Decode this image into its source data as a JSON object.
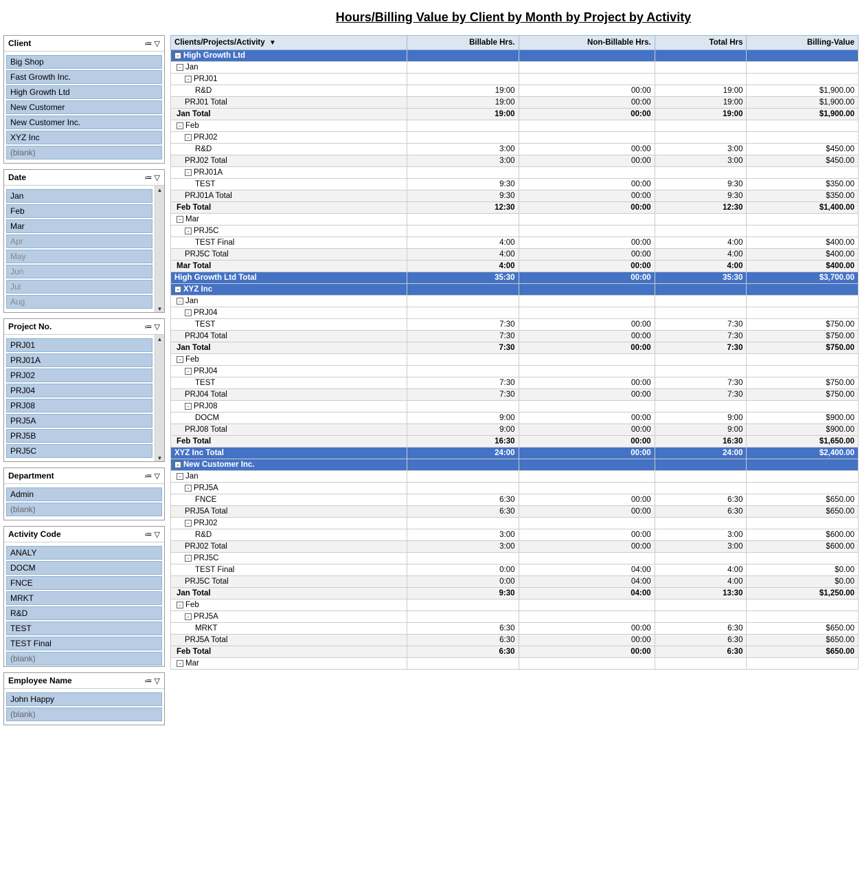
{
  "title": "Hours/Billing Value by Client by Month by Project by Activity",
  "filters": {
    "client": {
      "label": "Client",
      "items": [
        "Big Shop",
        "Fast Growth Inc.",
        "High Growth Ltd",
        "New Customer",
        "New Customer Inc.",
        "XYZ Inc",
        "(blank)"
      ]
    },
    "date": {
      "label": "Date",
      "items": [
        "Jan",
        "Feb",
        "Mar",
        "Apr",
        "May",
        "Jun",
        "Jul",
        "Aug"
      ]
    },
    "project": {
      "label": "Project No.",
      "items": [
        "PRJ01",
        "PRJ01A",
        "PRJ02",
        "PRJ04",
        "PRJ08",
        "PRJ5A",
        "PRJ5B",
        "PRJ5C"
      ]
    },
    "department": {
      "label": "Department",
      "items": [
        "Admin",
        "(blank)"
      ]
    },
    "activity": {
      "label": "Activity Code",
      "items": [
        "ANALY",
        "DOCM",
        "FNCE",
        "MRKT",
        "R&D",
        "TEST",
        "TEST Final",
        "(blank)"
      ]
    },
    "employee": {
      "label": "Employee Name",
      "items": [
        "John Happy",
        "(blank)"
      ]
    }
  },
  "table": {
    "headers": [
      "Clients/Projects/Activity",
      "Billable Hrs.",
      "Non-Billable Hrs.",
      "Total Hrs",
      "Billing-Value"
    ],
    "rows": [
      {
        "type": "client-header",
        "label": "⊟ High Growth Ltd",
        "indent": 0
      },
      {
        "type": "month-group",
        "label": "⊟ Jan",
        "indent": 1
      },
      {
        "type": "project-group",
        "label": "⊟ PRJ01",
        "indent": 2
      },
      {
        "type": "activity",
        "label": "R&D",
        "indent": 3,
        "billable": "19:00",
        "nonbillable": "00:00",
        "total": "19:00",
        "billing": "$1,900.00"
      },
      {
        "type": "project-total",
        "label": "PRJ01 Total",
        "indent": 2,
        "billable": "19:00",
        "nonbillable": "00:00",
        "total": "19:00",
        "billing": "$1,900.00"
      },
      {
        "type": "month-total",
        "label": "Jan Total",
        "indent": 1,
        "billable": "19:00",
        "nonbillable": "00:00",
        "total": "19:00",
        "billing": "$1,900.00"
      },
      {
        "type": "month-group",
        "label": "⊟ Feb",
        "indent": 1
      },
      {
        "type": "project-group",
        "label": "⊟ PRJ02",
        "indent": 2
      },
      {
        "type": "activity",
        "label": "R&D",
        "indent": 3,
        "billable": "3:00",
        "nonbillable": "00:00",
        "total": "3:00",
        "billing": "$450.00"
      },
      {
        "type": "project-total",
        "label": "PRJ02 Total",
        "indent": 2,
        "billable": "3:00",
        "nonbillable": "00:00",
        "total": "3:00",
        "billing": "$450.00"
      },
      {
        "type": "project-group",
        "label": "⊟ PRJ01A",
        "indent": 2
      },
      {
        "type": "activity",
        "label": "TEST",
        "indent": 3,
        "billable": "9:30",
        "nonbillable": "00:00",
        "total": "9:30",
        "billing": "$350.00"
      },
      {
        "type": "project-total",
        "label": "PRJ01A Total",
        "indent": 2,
        "billable": "9:30",
        "nonbillable": "00:00",
        "total": "9:30",
        "billing": "$350.00"
      },
      {
        "type": "month-total",
        "label": "Feb Total",
        "indent": 1,
        "billable": "12:30",
        "nonbillable": "00:00",
        "total": "12:30",
        "billing": "$1,400.00"
      },
      {
        "type": "month-group",
        "label": "⊟ Mar",
        "indent": 1
      },
      {
        "type": "project-group",
        "label": "⊟ PRJ5C",
        "indent": 2
      },
      {
        "type": "activity",
        "label": "TEST Final",
        "indent": 3,
        "billable": "4:00",
        "nonbillable": "00:00",
        "total": "4:00",
        "billing": "$400.00"
      },
      {
        "type": "project-total",
        "label": "PRJ5C Total",
        "indent": 2,
        "billable": "4:00",
        "nonbillable": "00:00",
        "total": "4:00",
        "billing": "$400.00"
      },
      {
        "type": "month-total",
        "label": "Mar Total",
        "indent": 1,
        "billable": "4:00",
        "nonbillable": "00:00",
        "total": "4:00",
        "billing": "$400.00"
      },
      {
        "type": "client-total",
        "label": "High Growth Ltd Total",
        "indent": 0,
        "billable": "35:30",
        "nonbillable": "00:00",
        "total": "35:30",
        "billing": "$3,700.00"
      },
      {
        "type": "client-header",
        "label": "⊟ XYZ Inc",
        "indent": 0
      },
      {
        "type": "month-group",
        "label": "⊟ Jan",
        "indent": 1
      },
      {
        "type": "project-group",
        "label": "⊟ PRJ04",
        "indent": 2
      },
      {
        "type": "activity",
        "label": "TEST",
        "indent": 3,
        "billable": "7:30",
        "nonbillable": "00:00",
        "total": "7:30",
        "billing": "$750.00"
      },
      {
        "type": "project-total",
        "label": "PRJ04 Total",
        "indent": 2,
        "billable": "7:30",
        "nonbillable": "00:00",
        "total": "7:30",
        "billing": "$750.00"
      },
      {
        "type": "month-total",
        "label": "Jan Total",
        "indent": 1,
        "billable": "7:30",
        "nonbillable": "00:00",
        "total": "7:30",
        "billing": "$750.00"
      },
      {
        "type": "month-group",
        "label": "⊟ Feb",
        "indent": 1
      },
      {
        "type": "project-group",
        "label": "⊟ PRJ04",
        "indent": 2
      },
      {
        "type": "activity",
        "label": "TEST",
        "indent": 3,
        "billable": "7:30",
        "nonbillable": "00:00",
        "total": "7:30",
        "billing": "$750.00"
      },
      {
        "type": "project-total",
        "label": "PRJ04 Total",
        "indent": 2,
        "billable": "7:30",
        "nonbillable": "00:00",
        "total": "7:30",
        "billing": "$750.00"
      },
      {
        "type": "project-group",
        "label": "⊟ PRJ08",
        "indent": 2
      },
      {
        "type": "activity",
        "label": "DOCM",
        "indent": 3,
        "billable": "9:00",
        "nonbillable": "00:00",
        "total": "9:00",
        "billing": "$900.00"
      },
      {
        "type": "project-total",
        "label": "PRJ08 Total",
        "indent": 2,
        "billable": "9:00",
        "nonbillable": "00:00",
        "total": "9:00",
        "billing": "$900.00"
      },
      {
        "type": "month-total",
        "label": "Feb Total",
        "indent": 1,
        "billable": "16:30",
        "nonbillable": "00:00",
        "total": "16:30",
        "billing": "$1,650.00"
      },
      {
        "type": "client-total",
        "label": "XYZ Inc Total",
        "indent": 0,
        "billable": "24:00",
        "nonbillable": "00:00",
        "total": "24:00",
        "billing": "$2,400.00"
      },
      {
        "type": "client-header",
        "label": "⊟ New Customer Inc.",
        "indent": 0
      },
      {
        "type": "month-group",
        "label": "⊟ Jan",
        "indent": 1
      },
      {
        "type": "project-group",
        "label": "⊟ PRJ5A",
        "indent": 2
      },
      {
        "type": "activity",
        "label": "FNCE",
        "indent": 3,
        "billable": "6:30",
        "nonbillable": "00:00",
        "total": "6:30",
        "billing": "$650.00"
      },
      {
        "type": "project-total",
        "label": "PRJ5A Total",
        "indent": 2,
        "billable": "6:30",
        "nonbillable": "00:00",
        "total": "6:30",
        "billing": "$650.00"
      },
      {
        "type": "project-group",
        "label": "⊟ PRJ02",
        "indent": 2
      },
      {
        "type": "activity",
        "label": "R&D",
        "indent": 3,
        "billable": "3:00",
        "nonbillable": "00:00",
        "total": "3:00",
        "billing": "$600.00"
      },
      {
        "type": "project-total",
        "label": "PRJ02 Total",
        "indent": 2,
        "billable": "3:00",
        "nonbillable": "00:00",
        "total": "3:00",
        "billing": "$600.00"
      },
      {
        "type": "project-group",
        "label": "⊟ PRJ5C",
        "indent": 2
      },
      {
        "type": "activity",
        "label": "TEST Final",
        "indent": 3,
        "billable": "0:00",
        "nonbillable": "04:00",
        "total": "4:00",
        "billing": "$0.00"
      },
      {
        "type": "project-total",
        "label": "PRJ5C Total",
        "indent": 2,
        "billable": "0:00",
        "nonbillable": "04:00",
        "total": "4:00",
        "billing": "$0.00"
      },
      {
        "type": "month-total",
        "label": "Jan Total",
        "indent": 1,
        "billable": "9:30",
        "nonbillable": "04:00",
        "total": "13:30",
        "billing": "$1,250.00"
      },
      {
        "type": "month-group",
        "label": "⊟ Feb",
        "indent": 1
      },
      {
        "type": "project-group",
        "label": "⊟ PRJ5A",
        "indent": 2
      },
      {
        "type": "activity",
        "label": "MRKT",
        "indent": 3,
        "billable": "6:30",
        "nonbillable": "00:00",
        "total": "6:30",
        "billing": "$650.00"
      },
      {
        "type": "project-total",
        "label": "PRJ5A Total",
        "indent": 2,
        "billable": "6:30",
        "nonbillable": "00:00",
        "total": "6:30",
        "billing": "$650.00"
      },
      {
        "type": "month-total",
        "label": "Feb Total",
        "indent": 1,
        "billable": "6:30",
        "nonbillable": "00:00",
        "total": "6:30",
        "billing": "$650.00"
      },
      {
        "type": "month-group",
        "label": "⊟ Mar",
        "indent": 1
      }
    ]
  }
}
